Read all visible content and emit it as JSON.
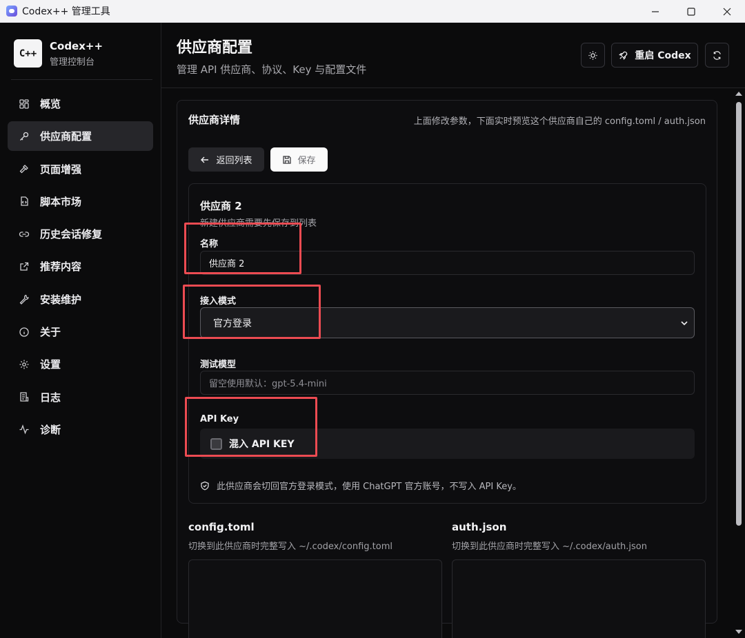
{
  "window": {
    "title": "Codex++ 管理工具"
  },
  "brand": {
    "logo": "C++",
    "name": "Codex++",
    "subtitle": "管理控制台"
  },
  "nav": {
    "items": [
      {
        "label": "概览",
        "icon": "grid-icon"
      },
      {
        "label": "供应商配置",
        "icon": "key-icon",
        "active": true
      },
      {
        "label": "页面增强",
        "icon": "hammer-icon"
      },
      {
        "label": "脚本市场",
        "icon": "script-icon"
      },
      {
        "label": "历史会话修复",
        "icon": "link-icon"
      },
      {
        "label": "推荐内容",
        "icon": "external-link-icon"
      },
      {
        "label": "安装维护",
        "icon": "wrench-icon"
      },
      {
        "label": "关于",
        "icon": "info-icon"
      },
      {
        "label": "设置",
        "icon": "gear-icon"
      },
      {
        "label": "日志",
        "icon": "log-icon"
      },
      {
        "label": "诊断",
        "icon": "pulse-icon"
      }
    ]
  },
  "header": {
    "title": "供应商配置",
    "subtitle": "管理 API 供应商、协议、Key 与配置文件",
    "restart_label": "重启 Codex"
  },
  "card": {
    "title": "供应商详情",
    "hint": "上面修改参数，下面实时预览这个供应商自己的 config.toml / auth.json",
    "back_label": "返回列表",
    "save_label": "保存"
  },
  "provider": {
    "name": "供应商 2",
    "note": "新建供应商需要先保存到列表",
    "name_label": "名称",
    "name_value": "供应商 2",
    "mode_label": "接入模式",
    "mode_value": "官方登录",
    "model_label": "测试模型",
    "model_placeholder": "留空使用默认：gpt-5.4-mini",
    "apikey_label": "API Key",
    "apikey_checkbox_label": "混入 API KEY",
    "apikey_checked": false,
    "info": "此供应商会切回官方登录模式，使用 ChatGPT 官方账号，不写入 API Key。"
  },
  "files": {
    "config": {
      "title": "config.toml",
      "subtitle": "切换到此供应商时完整写入 ~/.codex/config.toml"
    },
    "auth": {
      "title": "auth.json",
      "subtitle": "切换到此供应商时完整写入 ~/.codex/auth.json"
    }
  },
  "colors": {
    "accent_red": "#ec4b52",
    "active_nav": "#26262a"
  }
}
